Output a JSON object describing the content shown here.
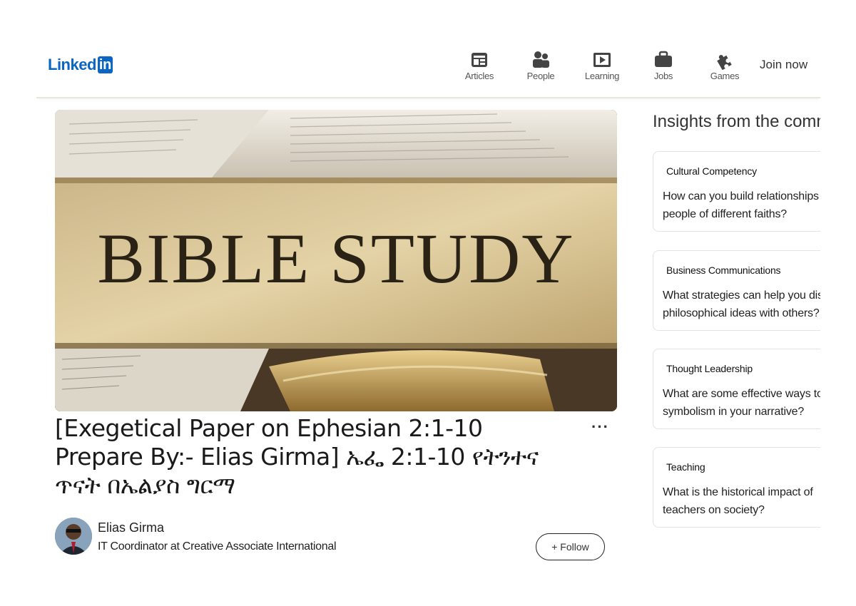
{
  "header": {
    "logo_text": "Linked",
    "logo_in": "in",
    "nav": [
      {
        "label": "Articles",
        "icon": "articles-icon"
      },
      {
        "label": "People",
        "icon": "people-icon"
      },
      {
        "label": "Learning",
        "icon": "learning-icon"
      },
      {
        "label": "Jobs",
        "icon": "jobs-icon"
      },
      {
        "label": "Games",
        "icon": "games-icon"
      }
    ],
    "join_label": "Join now"
  },
  "article": {
    "hero_text": "BIBLE STUDY",
    "title": "[Exegetical Paper on Ephesian 2:1-10 Prepare By:- Elias Girma] ኤፌ 2:1-10 የትንተና ጥናት በኤልያስ ግርማ",
    "more_label": "···",
    "author": {
      "name": "Elias Girma",
      "headline": "IT Coordinator at Creative Associate International",
      "follow_label": "+ Follow"
    }
  },
  "sidebar": {
    "title": "Insights from the community",
    "cards": [
      {
        "category": "Cultural Competency",
        "question": "How can you build relationships with people of different faiths?"
      },
      {
        "category": "Business Communications",
        "question": "What strategies can help you discuss philosophical ideas with others?"
      },
      {
        "category": "Thought Leadership",
        "question": "What are some effective ways to use symbolism in your narrative?"
      },
      {
        "category": "Teaching",
        "question": "What is the historical impact of teachers on society?"
      }
    ]
  },
  "colors": {
    "brand": "#0a66c2",
    "icon_gray": "#444444"
  }
}
